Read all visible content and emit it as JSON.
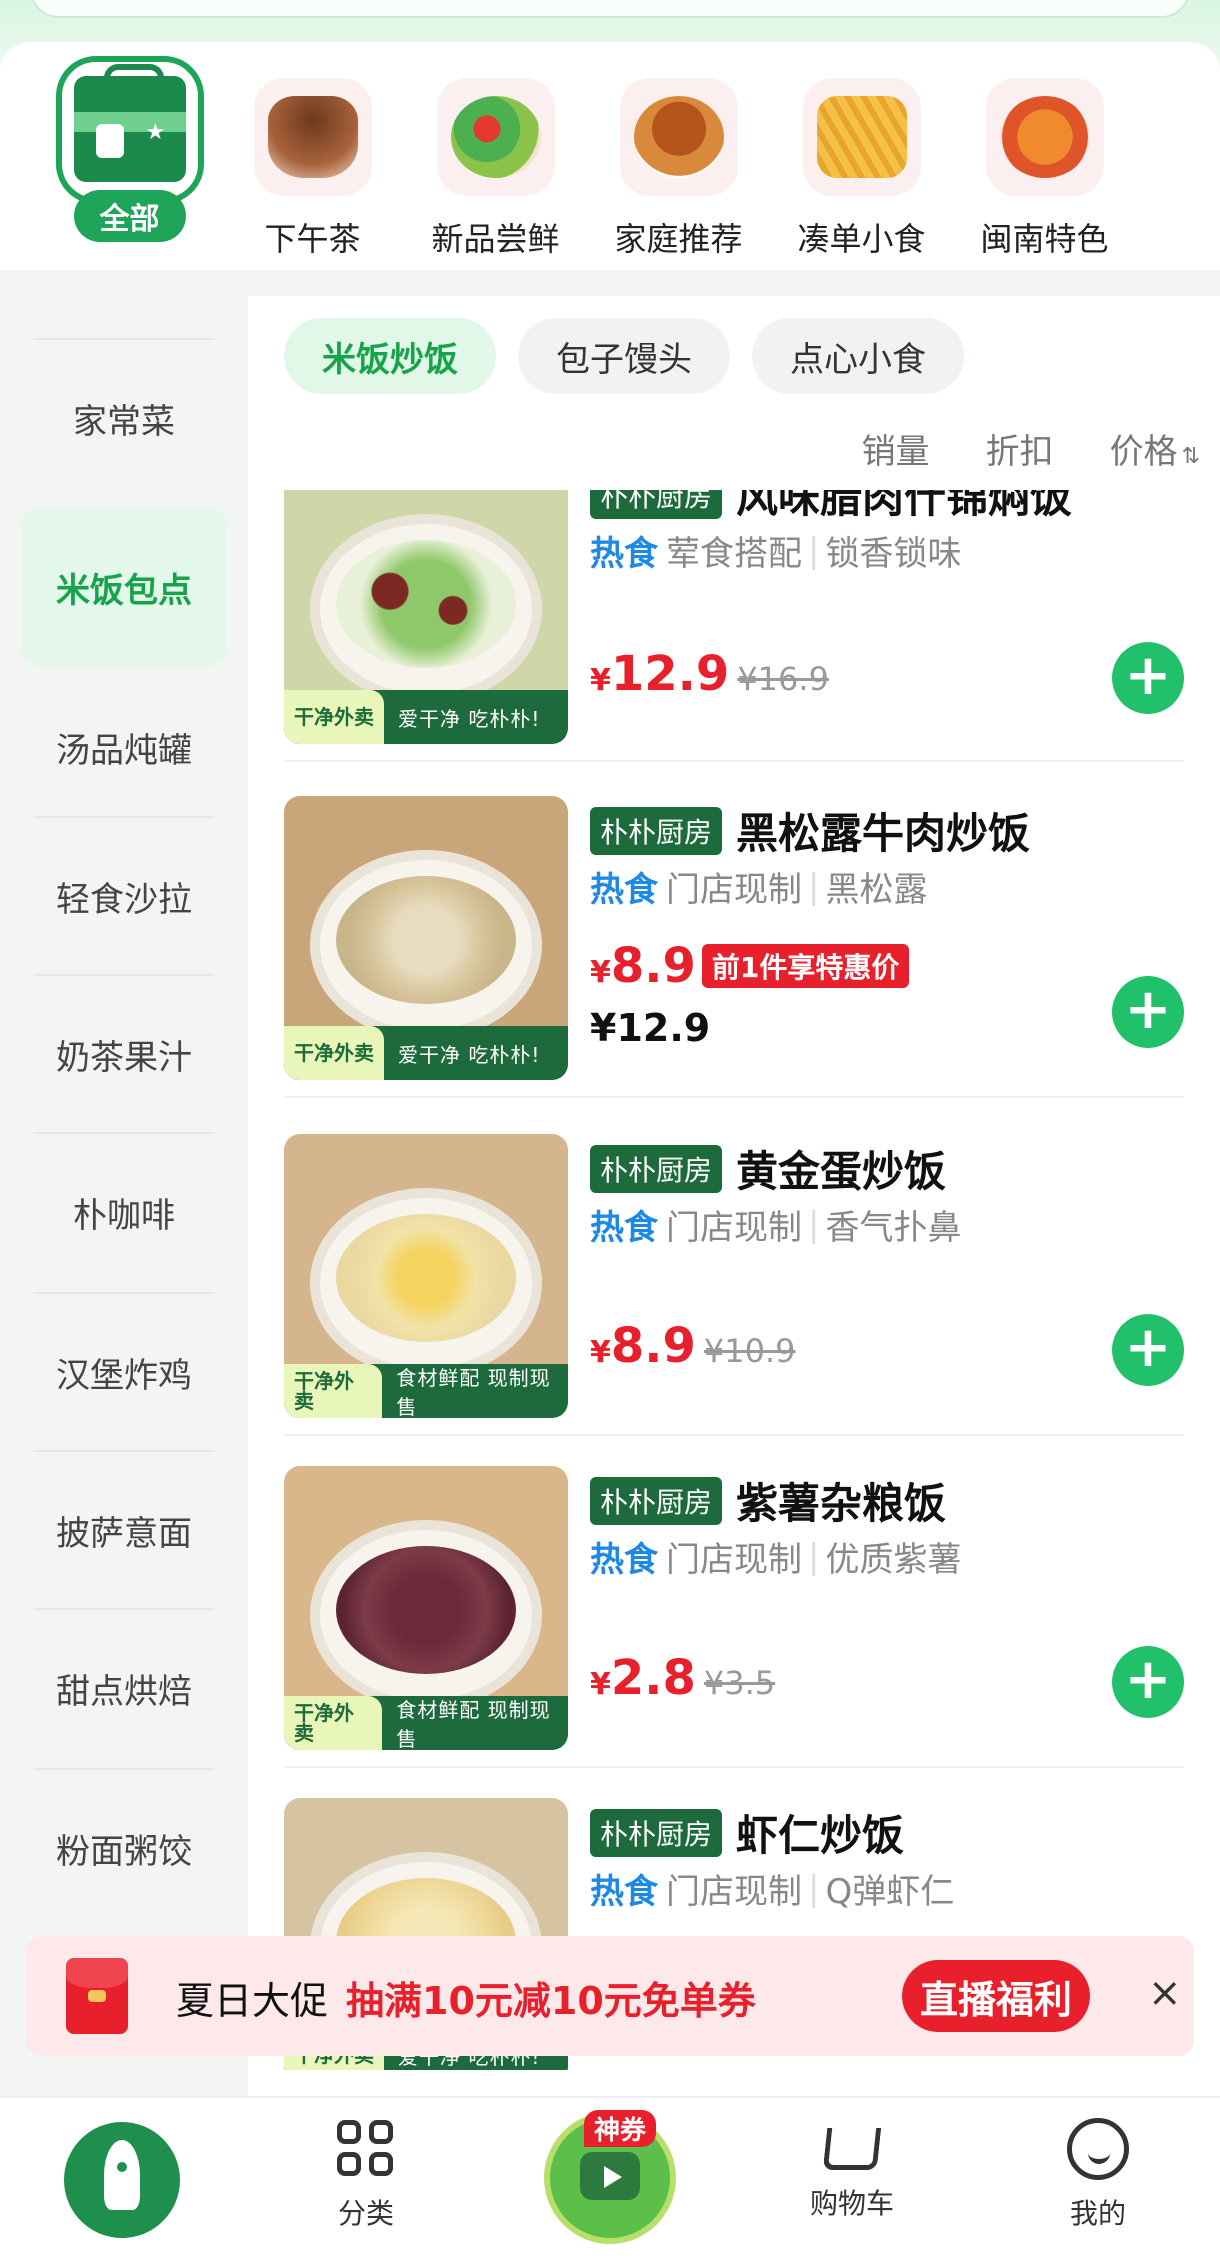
{
  "categories": [
    {
      "label": "全部",
      "active": true
    },
    {
      "label": "下午茶"
    },
    {
      "label": "新品尝鲜"
    },
    {
      "label": "家庭推荐"
    },
    {
      "label": "凑单小食"
    },
    {
      "label": "闽南特色"
    }
  ],
  "left_nav": [
    {
      "label": "家常菜"
    },
    {
      "label": "米饭包点",
      "active": true
    },
    {
      "label": "汤品炖罐"
    },
    {
      "label": "轻食沙拉"
    },
    {
      "label": "奶茶果汁"
    },
    {
      "label": "朴咖啡"
    },
    {
      "label": "汉堡炸鸡"
    },
    {
      "label": "披萨意面"
    },
    {
      "label": "甜点烘焙"
    },
    {
      "label": "粉面粥饺"
    }
  ],
  "sub_tabs": [
    {
      "label": "米饭炒饭",
      "active": true
    },
    {
      "label": "包子馒头"
    },
    {
      "label": "点心小食"
    }
  ],
  "sorts": {
    "sales": "销量",
    "discount": "折扣",
    "price": "价格"
  },
  "items": [
    {
      "brand": "朴朴厨房",
      "name": "风味腊肉什锦焖饭",
      "hot": "热食",
      "tag1": "荤食搭配",
      "tag2": "锁香锁味",
      "currency": "¥",
      "price": "12.9",
      "old": "¥16.9",
      "band_badge": "干净外卖",
      "band_text": "爱干净 吃朴朴!"
    },
    {
      "brand": "朴朴厨房",
      "name": "黑松露牛肉炒饭",
      "hot": "热食",
      "tag1": "门店现制",
      "tag2": "黑松露",
      "currency": "¥",
      "price": "8.9",
      "promo": "前1件享特惠价",
      "second_price": "¥12.9",
      "band_badge": "干净外卖",
      "band_text": "爱干净 吃朴朴!"
    },
    {
      "brand": "朴朴厨房",
      "name": "黄金蛋炒饭",
      "hot": "热食",
      "tag1": "门店现制",
      "tag2": "香气扑鼻",
      "currency": "¥",
      "price": "8.9",
      "old": "¥10.9",
      "band_badge": "干净外卖",
      "band_text": "食材鲜配 现制现售"
    },
    {
      "brand": "朴朴厨房",
      "name": "紫薯杂粮饭",
      "hot": "热食",
      "tag1": "门店现制",
      "tag2": "优质紫薯",
      "currency": "¥",
      "price": "2.8",
      "old": "¥3.5",
      "band_badge": "干净外卖",
      "band_text": "食材鲜配 现制现售"
    },
    {
      "brand": "朴朴厨房",
      "name": "虾仁炒饭",
      "hot": "热食",
      "tag1": "门店现制",
      "tag2": "Q弹虾仁",
      "band_badge": "干净外卖",
      "band_text": "爱干净 吃朴朴!"
    }
  ],
  "banner": {
    "title": "夏日大促",
    "desc": "抽满10元减10元免单券",
    "button": "直播福利",
    "close": "×"
  },
  "bottom_nav": {
    "category": "分类",
    "badge": "神券",
    "cart": "购物车",
    "me": "我的"
  },
  "colors": {
    "accent": "#16a34a",
    "price_red": "#e8202c",
    "brand_green": "#1d6a3c",
    "hot_blue": "#1e88e5"
  }
}
